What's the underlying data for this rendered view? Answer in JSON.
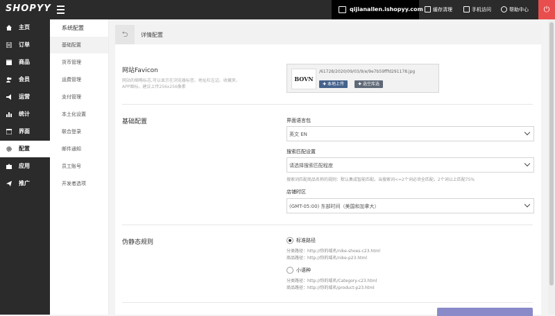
{
  "brand": {
    "logo": "SHOPYY"
  },
  "topbar": {
    "domain": "qijianallen.ishopyy.com",
    "clear_cache": "缓存清理",
    "mobile": "手机访问",
    "help": "帮助中心"
  },
  "sidebar": {
    "items": [
      {
        "label": "主页",
        "icon": "home-icon"
      },
      {
        "label": "订单",
        "icon": "orders-icon"
      },
      {
        "label": "商品",
        "icon": "box-icon"
      },
      {
        "label": "会员",
        "icon": "users-icon"
      },
      {
        "label": "运营",
        "icon": "megaphone-icon"
      },
      {
        "label": "统计",
        "icon": "bar-chart-icon"
      },
      {
        "label": "界面",
        "icon": "window-icon"
      },
      {
        "label": "配置",
        "icon": "gear-icon"
      },
      {
        "label": "应用",
        "icon": "puzzle-icon"
      },
      {
        "label": "推广",
        "icon": "paper-plane-icon"
      }
    ],
    "active": "配置"
  },
  "submenu": {
    "title": "系统配置",
    "items": [
      "基础配置",
      "货币管理",
      "运费管理",
      "支付管理",
      "本土化设置",
      "联合登录",
      "邮件通知",
      "员工账号",
      "开发者选项"
    ],
    "active": "基础配置"
  },
  "panel": {
    "title": "详情配置",
    "favicon": {
      "label": "网站Favicon",
      "desc": "网站的缩略标志,可以显示在浏览器标签、地址栏左边、收藏夹、APP图标。建议上传256x256像素",
      "thumb_text": "BOVN",
      "path": "/61728/2020/09/03/9/e/9e7b59fffd291178.jpg",
      "upload_btn": "本地上传",
      "choose_btn": "选空库选"
    },
    "basic": {
      "label": "基础配置",
      "language_label": "界面语言包",
      "language_value": "英文 EN",
      "search_label": "搜索匹配设置",
      "search_placeholder": "请选择搜索匹配程度",
      "search_hint": "搜索词匹配商品名称的规则：默认集成智能匹配。当搜索词<=2个词必须全匹配，2个词以上匹配75%",
      "timezone_label": "店铺时区",
      "timezone_value": "(GMT-05:00) 东部时间（美国和加拿大）"
    },
    "rewrite": {
      "label": "伪静态规则",
      "option1": {
        "label": "标准路径",
        "example1": "分类路径：http://你的域名/nike-shoes-c23.html",
        "example2": "商品路径：http://你的域名/nike-p23.html"
      },
      "option2": {
        "label": "小语种",
        "example1": "分类路径：http://你的域名/Category-c23.html",
        "example2": "商品路径：http://你的域名/product-p23.html"
      }
    }
  }
}
